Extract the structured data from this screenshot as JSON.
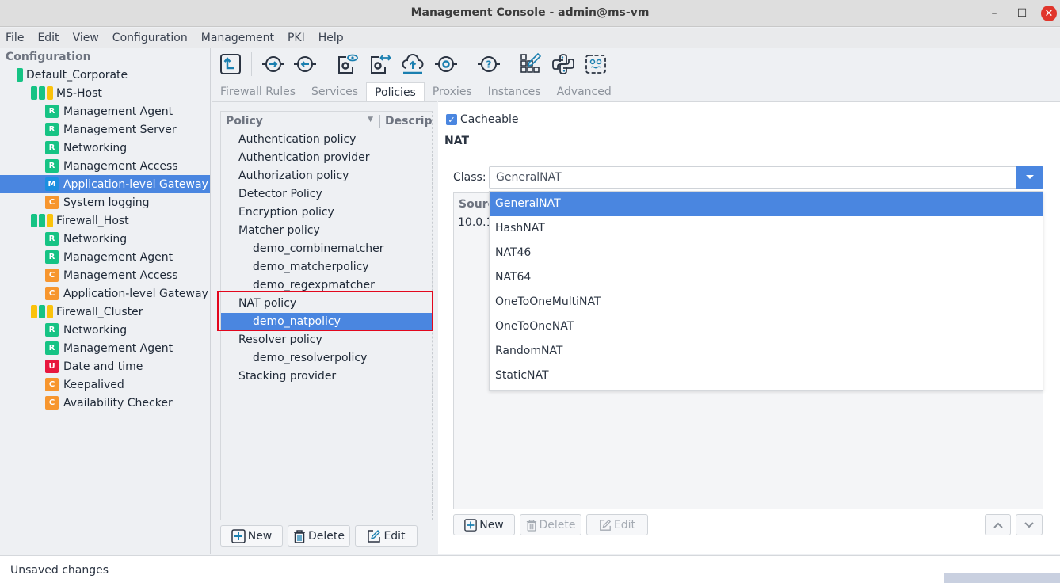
{
  "window": {
    "title": "Management Console - admin@ms-vm",
    "minimize": "–",
    "maximize": "☐",
    "close": "✕"
  },
  "menu": [
    "File",
    "Edit",
    "View",
    "Configuration",
    "Management",
    "PKI",
    "Help"
  ],
  "tree": {
    "header": "Configuration",
    "items": [
      {
        "label": "Default_Corporate",
        "level": 0,
        "status_bars": [
          "green"
        ]
      },
      {
        "label": "MS-Host",
        "level": 1,
        "status_bars": [
          "green",
          "green",
          "yellow"
        ]
      },
      {
        "label": "Management Agent",
        "level": 2,
        "badge": "R"
      },
      {
        "label": "Management Server",
        "level": 2,
        "badge": "R"
      },
      {
        "label": "Networking",
        "level": 2,
        "badge": "R"
      },
      {
        "label": "Management Access",
        "level": 2,
        "badge": "R"
      },
      {
        "label": "Application-level Gateway",
        "level": 2,
        "badge": "M",
        "selected": true
      },
      {
        "label": "System logging",
        "level": 2,
        "badge": "C"
      },
      {
        "label": "Firewall_Host",
        "level": 1,
        "status_bars": [
          "green",
          "green",
          "yellow"
        ]
      },
      {
        "label": "Networking",
        "level": 2,
        "badge": "R"
      },
      {
        "label": "Management Agent",
        "level": 2,
        "badge": "R"
      },
      {
        "label": "Management Access",
        "level": 2,
        "badge": "C"
      },
      {
        "label": "Application-level Gateway",
        "level": 2,
        "badge": "C"
      },
      {
        "label": "Firewall_Cluster",
        "level": 1,
        "status_bars": [
          "yellow",
          "green",
          "yellow"
        ]
      },
      {
        "label": "Networking",
        "level": 2,
        "badge": "R"
      },
      {
        "label": "Management Agent",
        "level": 2,
        "badge": "R"
      },
      {
        "label": "Date and time",
        "level": 2,
        "badge": "U"
      },
      {
        "label": "Keepalived",
        "level": 2,
        "badge": "C"
      },
      {
        "label": "Availability Checker",
        "level": 2,
        "badge": "C"
      }
    ]
  },
  "toolbar": {
    "buttons": [
      {
        "name": "home-icon"
      },
      {
        "name": "connect-icon"
      },
      {
        "name": "disconnect-icon"
      },
      {
        "name": "view-config-icon"
      },
      {
        "name": "compare-config-icon"
      },
      {
        "name": "upload-icon"
      },
      {
        "name": "reload-icon"
      },
      {
        "name": "help-icon"
      },
      {
        "name": "edit-grid-icon"
      },
      {
        "name": "python-icon"
      },
      {
        "name": "scripting-icon"
      }
    ]
  },
  "tabs": [
    {
      "label": "Firewall Rules"
    },
    {
      "label": "Services"
    },
    {
      "label": "Policies",
      "active": true
    },
    {
      "label": "Proxies"
    },
    {
      "label": "Instances"
    },
    {
      "label": "Advanced"
    }
  ],
  "policies": {
    "columns": [
      "Policy",
      "Description"
    ],
    "column_visible": [
      "Policy",
      "Descript"
    ],
    "rows": [
      {
        "label": "Authentication policy",
        "level": 0
      },
      {
        "label": "Authentication provider",
        "level": 0
      },
      {
        "label": "Authorization policy",
        "level": 0
      },
      {
        "label": "Detector Policy",
        "level": 0
      },
      {
        "label": "Encryption policy",
        "level": 0
      },
      {
        "label": "Matcher policy",
        "level": 0
      },
      {
        "label": "demo_combinematcher",
        "level": 1
      },
      {
        "label": "demo_matcherpolicy",
        "level": 1
      },
      {
        "label": "demo_regexpmatcher",
        "level": 1
      },
      {
        "label": "NAT policy",
        "level": 0
      },
      {
        "label": "demo_natpolicy",
        "level": 1,
        "selected": true
      },
      {
        "label": "Resolver policy",
        "level": 0
      },
      {
        "label": "demo_resolverpolicy",
        "level": 1
      },
      {
        "label": "Stacking provider",
        "level": 0
      }
    ],
    "buttons": {
      "new": "New",
      "delete": "Delete",
      "edit": "Edit"
    }
  },
  "detail": {
    "cacheable_label": "Cacheable",
    "cacheable_checked": true,
    "section_title": "NAT",
    "class_label": "Class:",
    "class_value": "GeneralNAT",
    "table_header": "Sourc",
    "table_cell": "10.0.1",
    "buttons": {
      "new": "New",
      "delete": "Delete",
      "edit": "Edit"
    },
    "dropdown_options": [
      {
        "label": "GeneralNAT",
        "selected": true
      },
      {
        "label": "HashNAT"
      },
      {
        "label": "NAT46"
      },
      {
        "label": "NAT64"
      },
      {
        "label": "OneToOneMultiNAT"
      },
      {
        "label": "OneToOneNAT"
      },
      {
        "label": "RandomNAT"
      },
      {
        "label": "StaticNAT"
      }
    ]
  },
  "status": {
    "text": "Unsaved changes"
  },
  "colors": {
    "accent": "#4a86e0",
    "badge_R": "#16c384",
    "badge_M": "#1a8fe0",
    "badge_C": "#f7962e",
    "badge_U": "#e8173e",
    "status_green": "#16c384",
    "status_yellow": "#fbc20b",
    "highlight": "#e3071d"
  }
}
